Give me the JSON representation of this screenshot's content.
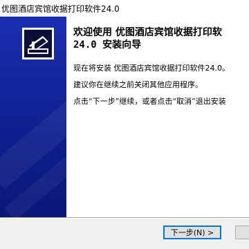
{
  "window": {
    "title": "优图酒店宾馆收据打印软件24.0"
  },
  "banner": {
    "logo_icon": "printer-icon"
  },
  "content": {
    "heading_line1": "欢迎使用 优图酒店宾馆收据打印软",
    "heading_line2": "24.0 安装向导",
    "para1": "现在将安装 优图酒店宾馆收据打印软件24.0。",
    "para2": "建议你在继续之前关闭其他应用程序。",
    "para3": "点击“下一步”继续，或者点击“取消”退出安装"
  },
  "footer": {
    "next_label": "下一步(N) >"
  },
  "colors": {
    "banner": "#0e1e8e",
    "button_focus": "#0078d7"
  }
}
